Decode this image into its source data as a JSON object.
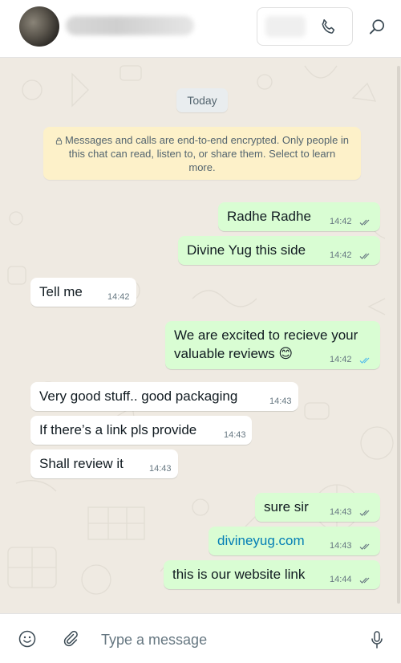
{
  "header": {
    "icons": {
      "call": "phone-icon",
      "search": "search-icon"
    }
  },
  "chat": {
    "date_label": "Today",
    "encryption_notice": "Messages and calls are end-to-end encrypted. Only people in this chat can read, listen to, or share them. Select to learn more.",
    "messages": [
      {
        "direction": "outgoing",
        "text": "Radhe Radhe",
        "time": "14:42",
        "status": "delivered"
      },
      {
        "direction": "outgoing",
        "text": "Divine Yug this side",
        "time": "14:42",
        "status": "delivered"
      },
      {
        "direction": "incoming",
        "text": "Tell me",
        "time": "14:42"
      },
      {
        "direction": "outgoing",
        "text": "We are excited to recieve your valuable reviews 😊",
        "time": "14:42",
        "status": "read"
      },
      {
        "direction": "incoming",
        "text": "Very good stuff.. good packaging",
        "time": "14:43"
      },
      {
        "direction": "incoming",
        "text": "If there’s a link pls provide",
        "time": "14:43"
      },
      {
        "direction": "incoming",
        "text": "Shall review it",
        "time": "14:43"
      },
      {
        "direction": "outgoing",
        "text": "sure sir",
        "time": "14:43",
        "status": "delivered"
      },
      {
        "direction": "outgoing",
        "text": "divineyug.com",
        "time": "14:43",
        "status": "delivered",
        "is_link": true
      },
      {
        "direction": "outgoing",
        "text": "this is our website link",
        "time": "14:44",
        "status": "delivered"
      }
    ]
  },
  "composer": {
    "placeholder": "Type a message",
    "value": "",
    "icons": {
      "emoji": "emoji-icon",
      "attach": "paperclip-icon",
      "mic": "microphone-icon"
    }
  },
  "colors": {
    "outgoing_bubble": "#d9fdd3",
    "incoming_bubble": "#ffffff",
    "chat_background": "#efeae2",
    "notice_background": "#fdf1c9",
    "read_ticks": "#53bdeb",
    "delivered_ticks": "#667781",
    "link": "#027eb5"
  }
}
